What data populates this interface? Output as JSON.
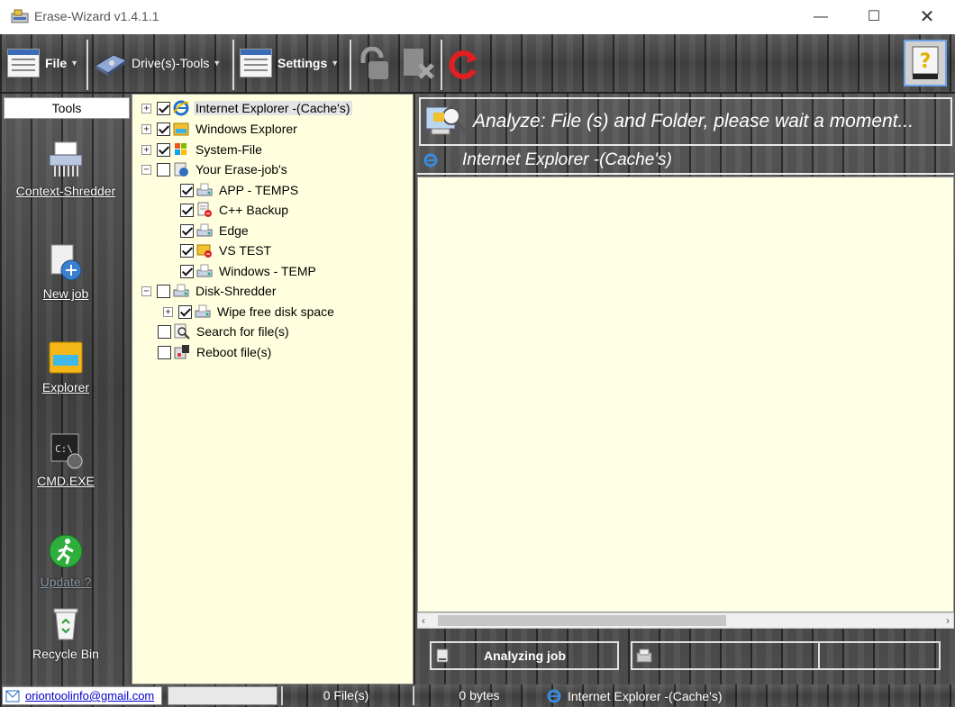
{
  "window": {
    "title": "Erase-Wizard v1.4.1.1",
    "minimize": "—",
    "maximize": "☐",
    "close": "✕"
  },
  "toolbar": {
    "file_label": "File",
    "drive_tools_label": "Drive(s)-Tools",
    "settings_label": "Settings"
  },
  "tools": {
    "header": "Tools",
    "items": [
      {
        "label": "Context-Shredder",
        "icon": "shredder-icon"
      },
      {
        "label": "New job",
        "icon": "new-job-icon"
      },
      {
        "label": "Explorer",
        "icon": "folder-icon"
      },
      {
        "label": "CMD.EXE",
        "icon": "cmd-icon"
      },
      {
        "label": "Update ?",
        "icon": "update-icon"
      },
      {
        "label": "Recycle Bin",
        "icon": "recycle-bin-icon"
      }
    ]
  },
  "tree": {
    "items": [
      {
        "label": "Internet Explorer -(Cache's)",
        "checked": true,
        "expander": "+",
        "icon": "ie-icon",
        "level": 0,
        "selected": true
      },
      {
        "label": "Windows Explorer",
        "checked": true,
        "expander": "+",
        "icon": "windows-explorer-icon",
        "level": 0
      },
      {
        "label": "System-File",
        "checked": true,
        "expander": "+",
        "icon": "windows-logo-icon",
        "level": 0
      },
      {
        "label": "Your Erase-job's",
        "checked": false,
        "expander": "−",
        "icon": "jobs-icon",
        "level": 0
      },
      {
        "label": "APP - TEMPS",
        "checked": true,
        "expander": "",
        "icon": "drive-icon",
        "level": 1
      },
      {
        "label": "C++ Backup",
        "checked": true,
        "expander": "",
        "icon": "file-error-icon",
        "level": 1
      },
      {
        "label": "Edge",
        "checked": true,
        "expander": "",
        "icon": "drive-icon",
        "level": 1
      },
      {
        "label": "VS TEST",
        "checked": true,
        "expander": "",
        "icon": "folder-error-icon",
        "level": 1
      },
      {
        "label": "Windows - TEMP",
        "checked": true,
        "expander": "",
        "icon": "drive-icon",
        "level": 1
      },
      {
        "label": "Disk-Shredder",
        "checked": false,
        "expander": "−",
        "icon": "drive-icon",
        "level": 0
      },
      {
        "label": "Wipe free disk space",
        "checked": true,
        "expander": "+",
        "icon": "drive-icon",
        "level": 1
      },
      {
        "label": "Search for file(s)",
        "checked": false,
        "expander": "",
        "icon": "search-icon",
        "level": 0
      },
      {
        "label": "Reboot file(s)",
        "checked": false,
        "expander": "",
        "icon": "reboot-icon",
        "level": 0
      }
    ]
  },
  "right": {
    "banner_text": "Analyze: File (s) and Folder, please wait a moment...",
    "current_job": "Internet Explorer -(Cache's)",
    "analyzing_label": "Analyzing job"
  },
  "statusbar": {
    "email": "oriontoolinfo@gmail.com",
    "files": "0 File(s)",
    "bytes": "0 bytes",
    "job": "Internet Explorer -(Cache's)"
  },
  "colors": {
    "tree_bg": "#ffffdf",
    "content_bg": "#ffffe6",
    "wood_dark": "#4e4e4e",
    "link_blue": "#0000cc"
  }
}
